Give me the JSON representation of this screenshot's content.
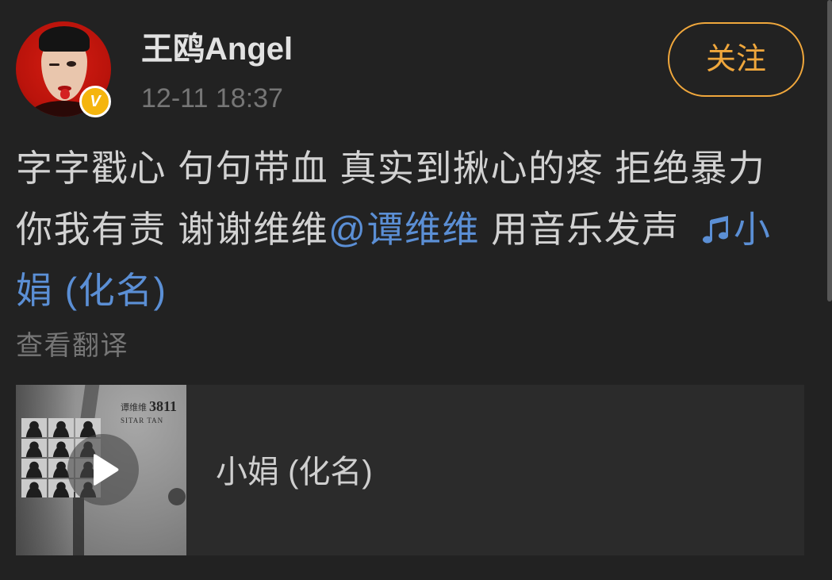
{
  "colors": {
    "background": "#222222",
    "title": "#e2e2e2",
    "text": "#d2d2d2",
    "secondary": "#767676",
    "link": "#5b8fd5",
    "follow_accent": "#f0a73c",
    "badge": "#f5b50e",
    "card": "#2b2b2b"
  },
  "post": {
    "author": {
      "name": "王鸥Angel",
      "verified_icon": "verified-badge-icon",
      "verified_letter": "V"
    },
    "timestamp": "12-11 18:37",
    "follow_label": "关注",
    "content": {
      "text_before_mention": "字字戳心 句句带血 真实到揪心的疼 拒绝暴力 你我有责 谢谢维维",
      "mention": "@谭维维",
      "text_after_mention": " 用音乐发声 ",
      "music_link_icon": "music-note-icon",
      "music_link_text": "小娟 (化名)"
    },
    "translate_label": "查看翻译",
    "music_card": {
      "title": "小娟 (化名)",
      "play_icon": "play-icon",
      "cover": {
        "artist": "谭维维",
        "album": "3811",
        "artist_en": "SITAR TAN"
      }
    }
  }
}
